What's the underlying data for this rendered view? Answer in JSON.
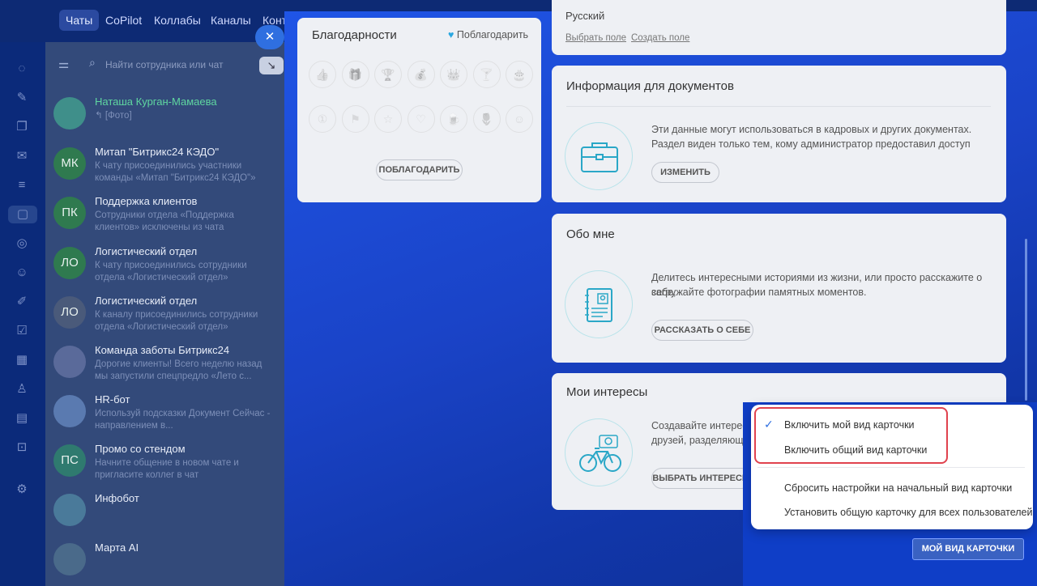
{
  "top_nav": {
    "tabs": [
      "Чаты",
      "CoPilot",
      "Коллабы",
      "Каналы",
      "Конт"
    ]
  },
  "chat_panel": {
    "search_placeholder": "Найти сотрудника или чат",
    "chats": [
      {
        "name": "Наташа Курган-Мамаева",
        "preview": "↰ [Фото]",
        "initials": "",
        "color": "#3f8f8a"
      },
      {
        "name": "Митап \"Битрикс24 КЭДО\"",
        "preview": "К чату присоединились участники команды «Митап \"Битрикс24 КЭДО\"»",
        "initials": "МК",
        "color": "#2f7a4f"
      },
      {
        "name": "Поддержка клиентов",
        "preview": "Сотрудники отдела «Поддержка клиентов» исключены из чата",
        "initials": "ПК",
        "color": "#2f7a4f"
      },
      {
        "name": "Логистический отдел",
        "preview": "К чату присоединились сотрудники отдела «Логистический отдел»",
        "initials": "ЛО",
        "color": "#2f7a4f"
      },
      {
        "name": "Логистический отдел",
        "preview": "К каналу присоединились сотрудники отдела «Логистический отдел»",
        "initials": "ЛО",
        "color": "#4a5a7a"
      },
      {
        "name": "Команда заботы Битрикс24",
        "preview": "Дорогие клиенты! Всего неделю назад мы запустили спецпредло «Лето с...",
        "initials": "",
        "color": "#5a6a9a"
      },
      {
        "name": "HR-бот",
        "preview": "Используй подсказки Документ Сейчас - направлением в...",
        "initials": "",
        "color": "#5a7ab0"
      },
      {
        "name": "Промо со стендом",
        "preview": "Начните общение в новом чате и пригласите коллег в чат",
        "initials": "ПС",
        "color": "#2f7a6f"
      },
      {
        "name": "Инфобот",
        "preview": "",
        "initials": "",
        "color": "#4a7a9a"
      },
      {
        "name": "Марта AI",
        "preview": "",
        "initials": "",
        "color": "#4a6a8a"
      }
    ]
  },
  "top_section": {
    "language_value": "Русский",
    "select_field": "Выбрать поле",
    "create_field": "Создать поле"
  },
  "thanks": {
    "title": "Благодарности",
    "thank_link": "Поблагодарить",
    "button": "ПОБЛАГОДАРИТЬ"
  },
  "docs_info": {
    "title": "Информация для документов",
    "desc1": "Эти данные могут использоваться в кадровых и других документах.",
    "desc2": "Раздел виден только тем, кому администратор предоставил доступ",
    "button": "ИЗМЕНИТЬ"
  },
  "about": {
    "title": "Обо мне",
    "desc1": "Делитесь интересными историями из жизни, или просто расскажите о себе,",
    "desc2": "загружайте фотографии памятных моментов.",
    "button": "РАССКАЗАТЬ О СЕБЕ"
  },
  "interests": {
    "title": "Мои интересы",
    "desc1": "Создавайте интересы",
    "desc2": "друзей, разделяющи",
    "button": "ВЫБРАТЬ ИНТЕРЕСЫ"
  },
  "menu": {
    "items": [
      "Включить мой вид карточки",
      "Включить общий вид карточки",
      "Сбросить настройки на начальный вид карточки",
      "Установить общую карточку для всех пользователей"
    ],
    "checked_index": 0
  },
  "my_card_button": "МОЙ ВИД КАРТОЧКИ",
  "colors": {
    "accent": "#2f6fe0",
    "highlight": "#e0424e",
    "icon_teal": "#2aa7c7"
  }
}
